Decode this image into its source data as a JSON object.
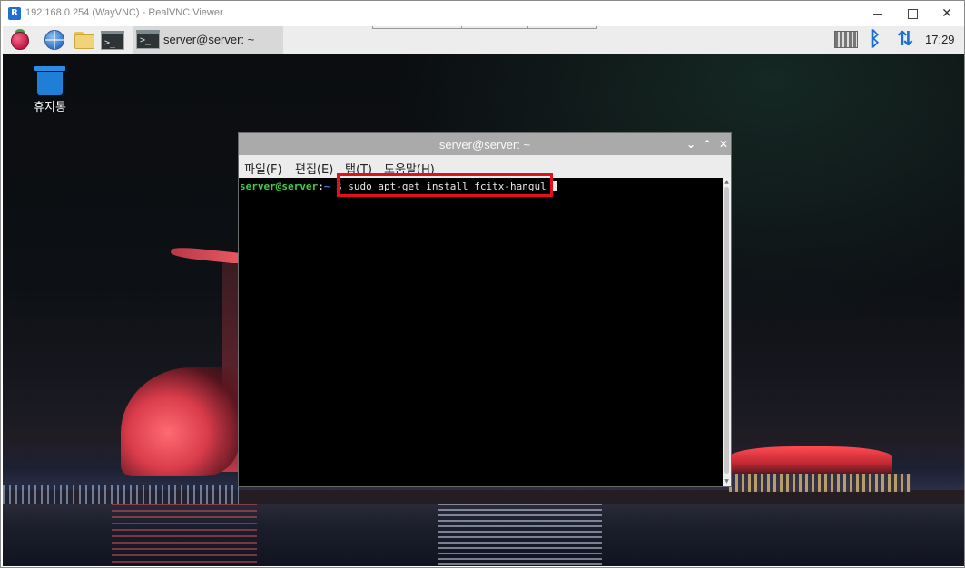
{
  "vnc": {
    "title": "192.168.0.254 (WayVNC) - RealVNC Viewer",
    "app_icon": "R"
  },
  "panel": {
    "task_label": "server@server: ~",
    "clock": "17:29",
    "term_glyph": ">_",
    "bluetooth_glyph": "ᛒ",
    "network_glyph": "⇅"
  },
  "desktop": {
    "trash_label": "휴지통"
  },
  "terminal": {
    "title": "server@server: ~",
    "menu": [
      "파일(F)",
      "편집(E)",
      "탭(T)",
      "도움말(H)"
    ],
    "prompt_user": "server@server",
    "prompt_sep": ":",
    "prompt_path": "~",
    "prompt_dollar": " $",
    "command": "sudo apt-get install fcitx-hangul"
  },
  "colors": {
    "highlight_box": "#e2101a",
    "prompt_user": "#3fd043",
    "prompt_path": "#4a7fe0",
    "tray_accent": "#1a6fd6"
  }
}
